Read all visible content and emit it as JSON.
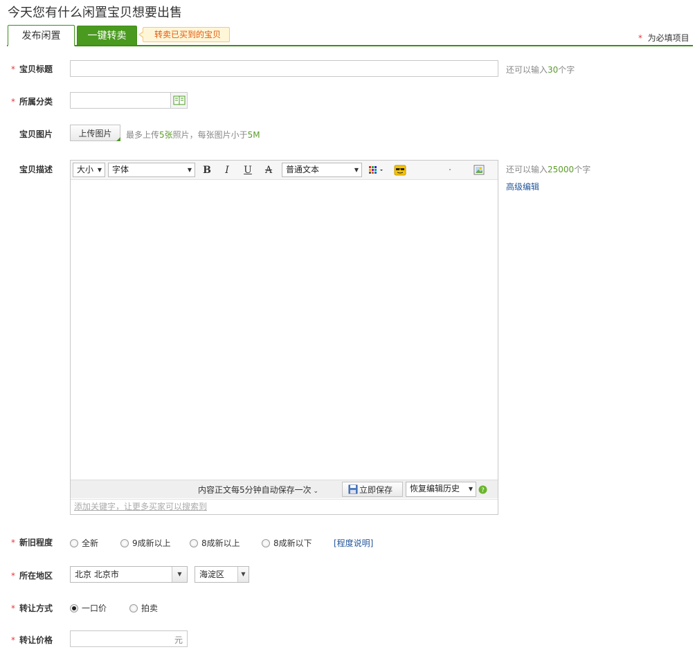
{
  "header": {
    "title": "今天您有什么闲置宝贝想要出售",
    "tabs": [
      {
        "label": "发布闲置"
      },
      {
        "label": "一键转卖"
      }
    ],
    "resell_tip": "转卖已买到的宝贝",
    "required_star": "*",
    "required_note": "为必填项目"
  },
  "form": {
    "title_field": {
      "label": "宝贝标题",
      "value": "",
      "hint_prefix": "还可以输入",
      "hint_num": "30",
      "hint_suffix": "个字"
    },
    "category": {
      "label": "所属分类",
      "value": ""
    },
    "images": {
      "label": "宝贝图片",
      "button": "上传图片",
      "hint_a": "最多上传",
      "hint_num1": "5张",
      "hint_b": "照片，每张图片小于",
      "hint_num2": "5M"
    },
    "description": {
      "label": "宝贝描述",
      "hint_prefix": "还可以输入",
      "hint_num": "25000",
      "hint_suffix": "个字",
      "advanced_link": "高级编辑",
      "toolbar": {
        "size": "大小",
        "font": "字体",
        "bold": "B",
        "italic": "I",
        "underline": "U",
        "strike": "A",
        "format": "普通文本",
        "dot": "·"
      },
      "autosave_note": "内容正文每5分钟自动保存一次",
      "save_now": "立即保存",
      "restore_history": "恢复编辑历史",
      "tags_placeholder": "添加关键字，让更多买家可以搜索到"
    },
    "condition": {
      "label": "新旧程度",
      "options": [
        "全新",
        "9成新以上",
        "8成新以上",
        "8成新以下"
      ],
      "help_link": "[程度说明]"
    },
    "location": {
      "label": "所在地区",
      "city": "北京  北京市",
      "district": "海淀区"
    },
    "transfer": {
      "label": "转让方式",
      "options": [
        "一口价",
        "拍卖"
      ],
      "selected": 0
    },
    "price": {
      "label": "转让价格",
      "unit": "元",
      "value": ""
    }
  },
  "colors": {
    "accent_green": "#4a9a1f",
    "required_red": "#e4393c",
    "link_blue": "#25579b",
    "tip_orange": "#e2570c"
  }
}
